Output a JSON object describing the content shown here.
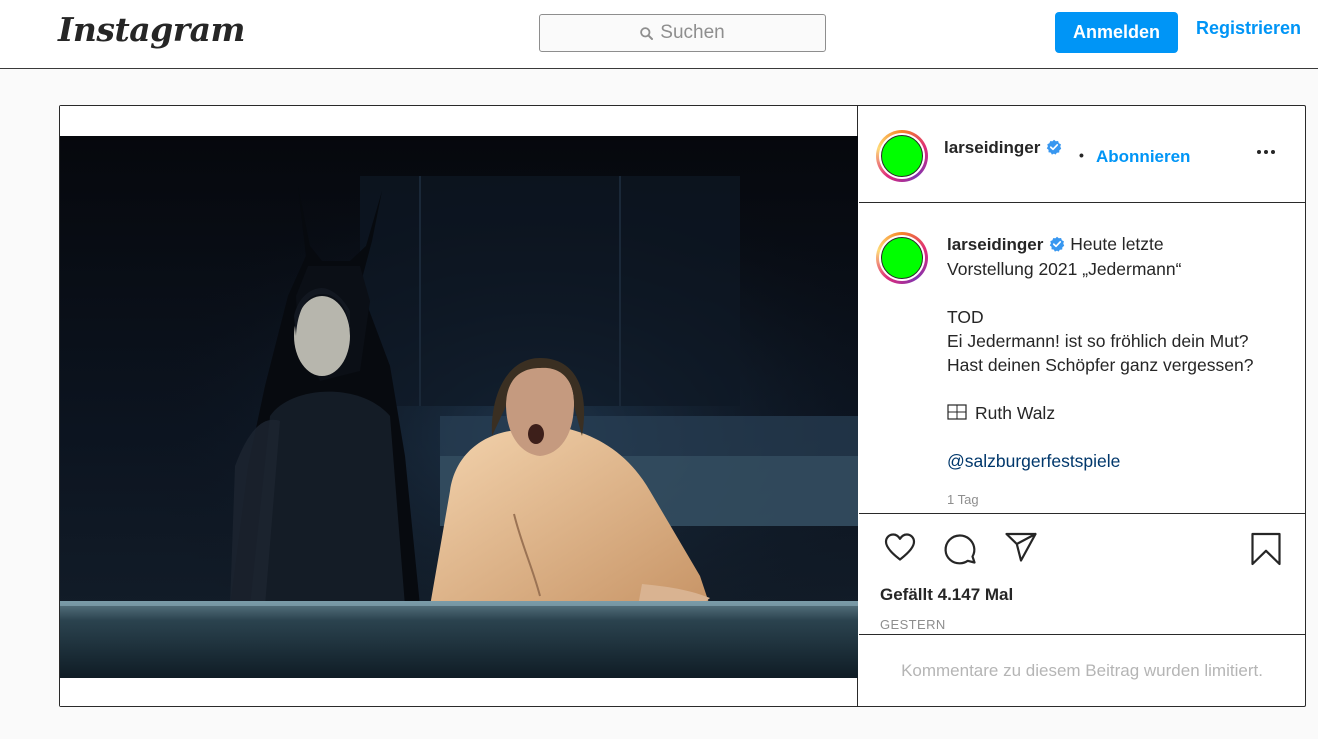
{
  "nav": {
    "logo_text": "Instagram",
    "search_placeholder": "Suchen",
    "search_icon": "search-icon",
    "login_label": "Anmelden",
    "register_label": "Registrieren",
    "accent_color": "#0095f6"
  },
  "post": {
    "image_description_icon": "photo",
    "header": {
      "username": "larseidinger",
      "verified_icon": "verified-badge-icon",
      "separator": "•",
      "follow_label": "Abonnieren",
      "more_icon": "more-options-icon"
    },
    "caption": {
      "username": "larseidinger",
      "lines": [
        "Heute letzte",
        "Vorstellung 2021 „Jedermann“",
        "",
        "TOD",
        "Ei Jedermann! ist so fröhlich dein Mut?",
        "Hast deinen Schöpfer ganz vergessen?",
        "",
        "Ruth Walz",
        "",
        "@salzburgerfestspiele"
      ],
      "first_line": "Heute letzte",
      "second_line": "Vorstellung 2021 „Jedermann“",
      "tod": "TOD",
      "quote_line_1": "Ei Jedermann! ist so fröhlich dein Mut?",
      "quote_line_2": "Hast deinen Schöpfer ganz vergessen?",
      "photo_credit": "Ruth Walz",
      "mention": "@salzburgerfestspiele",
      "time_ago": "1 Tag"
    },
    "actions": {
      "like_icon": "heart-icon",
      "comment_icon": "comment-icon",
      "share_icon": "send-icon",
      "save_icon": "bookmark-icon",
      "likes_text": "Gefällt 4.147 Mal",
      "date_text": "GESTERN"
    },
    "comments_limited_text": "Kommentare zu diesem Beitrag wurden limitiert."
  }
}
